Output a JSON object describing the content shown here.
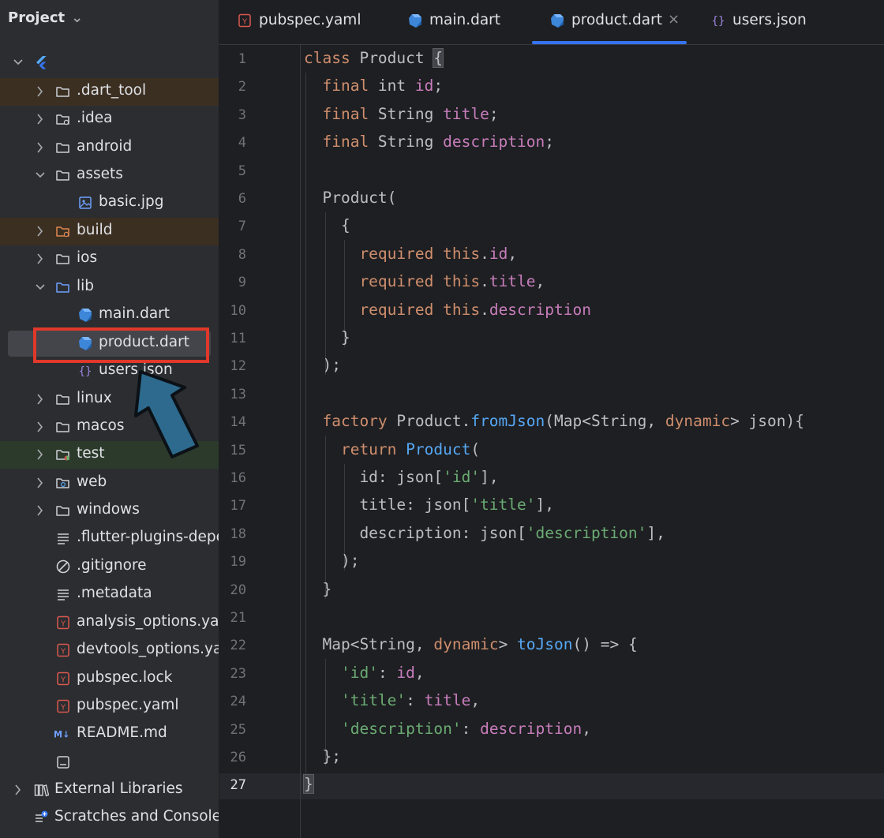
{
  "sidebar": {
    "title": "Project",
    "items": [
      {
        "label": "",
        "icon": "flutter-icon",
        "toggle": "expanded"
      },
      {
        "label": ".dart_tool",
        "icon": "folder-icon",
        "toggle": "collapsed"
      },
      {
        "label": ".idea",
        "icon": "folder-settings-icon",
        "toggle": "collapsed"
      },
      {
        "label": "android",
        "icon": "folder-icon",
        "toggle": "collapsed"
      },
      {
        "label": "assets",
        "icon": "folder-icon",
        "toggle": "expanded"
      },
      {
        "label": "basic.jpg",
        "icon": "image-file-icon",
        "toggle": "none"
      },
      {
        "label": "build",
        "icon": "folder-excluded-icon",
        "toggle": "collapsed"
      },
      {
        "label": "ios",
        "icon": "folder-icon",
        "toggle": "collapsed"
      },
      {
        "label": "lib",
        "icon": "source-folder-icon",
        "toggle": "expanded"
      },
      {
        "label": "main.dart",
        "icon": "dart-file-icon",
        "toggle": "none"
      },
      {
        "label": "product.dart",
        "icon": "dart-file-icon",
        "toggle": "none"
      },
      {
        "label": "users.json",
        "icon": "json-file-icon",
        "toggle": "none"
      },
      {
        "label": "linux",
        "icon": "folder-icon",
        "toggle": "collapsed"
      },
      {
        "label": "macos",
        "icon": "folder-icon",
        "toggle": "collapsed"
      },
      {
        "label": "test",
        "icon": "test-folder-icon",
        "toggle": "collapsed"
      },
      {
        "label": "web",
        "icon": "web-folder-icon",
        "toggle": "collapsed"
      },
      {
        "label": "windows",
        "icon": "folder-icon",
        "toggle": "collapsed"
      },
      {
        "label": ".flutter-plugins-depe",
        "icon": "text-file-icon",
        "toggle": "none"
      },
      {
        "label": ".gitignore",
        "icon": "ignore-file-icon",
        "toggle": "none"
      },
      {
        "label": ".metadata",
        "icon": "text-file-icon",
        "toggle": "none"
      },
      {
        "label": "analysis_options.yan",
        "icon": "yaml-file-icon",
        "toggle": "none"
      },
      {
        "label": "devtools_options.yan",
        "icon": "yaml-file-icon",
        "toggle": "none"
      },
      {
        "label": "pubspec.lock",
        "icon": "yaml-file-icon",
        "toggle": "none"
      },
      {
        "label": "pubspec.yaml",
        "icon": "yaml-file-icon",
        "toggle": "none"
      },
      {
        "label": "README.md",
        "icon": "markdown-file-icon",
        "toggle": "none"
      },
      {
        "label": "",
        "icon": "generic-file-icon",
        "toggle": "none"
      },
      {
        "label": "External Libraries",
        "icon": "libraries-icon",
        "toggle": "collapsed"
      },
      {
        "label": "Scratches and Consoles",
        "icon": "scratches-icon",
        "toggle": "none"
      }
    ]
  },
  "tabs": [
    {
      "label": "pubspec.yaml",
      "icon": "yaml-file-icon",
      "active": false
    },
    {
      "label": "main.dart",
      "icon": "dart-file-icon",
      "active": false
    },
    {
      "label": "product.dart",
      "icon": "dart-file-icon",
      "active": true,
      "close": "×"
    },
    {
      "label": "users.json",
      "icon": "json-file-icon",
      "active": false
    }
  ],
  "editor": {
    "line_numbers": [
      "1",
      "2",
      "3",
      "4",
      "5",
      "6",
      "7",
      "8",
      "9",
      "10",
      "11",
      "12",
      "13",
      "14",
      "15",
      "16",
      "17",
      "18",
      "19",
      "20",
      "21",
      "22",
      "23",
      "24",
      "25",
      "26",
      "27"
    ],
    "current_line": 27,
    "code": [
      [
        {
          "t": "class ",
          "c": "kw"
        },
        {
          "t": "Product ",
          "c": "plain"
        },
        {
          "t": "{",
          "c": "plain bm"
        }
      ],
      [
        {
          "t": "  final ",
          "c": "kw"
        },
        {
          "t": "int ",
          "c": "plain"
        },
        {
          "t": "id",
          "c": "fld"
        },
        {
          "t": ";",
          "c": "plain"
        }
      ],
      [
        {
          "t": "  final ",
          "c": "kw"
        },
        {
          "t": "String ",
          "c": "plain"
        },
        {
          "t": "title",
          "c": "fld"
        },
        {
          "t": ";",
          "c": "plain"
        }
      ],
      [
        {
          "t": "  final ",
          "c": "kw"
        },
        {
          "t": "String ",
          "c": "plain"
        },
        {
          "t": "description",
          "c": "fld"
        },
        {
          "t": ";",
          "c": "plain"
        }
      ],
      [],
      [
        {
          "t": "  Product(",
          "c": "plain"
        }
      ],
      [
        {
          "t": "    {",
          "c": "plain"
        }
      ],
      [
        {
          "t": "      required ",
          "c": "kw"
        },
        {
          "t": "this",
          "c": "kw"
        },
        {
          "t": ".",
          "c": "plain"
        },
        {
          "t": "id",
          "c": "fld"
        },
        {
          "t": ",",
          "c": "plain"
        }
      ],
      [
        {
          "t": "      required ",
          "c": "kw"
        },
        {
          "t": "this",
          "c": "kw"
        },
        {
          "t": ".",
          "c": "plain"
        },
        {
          "t": "title",
          "c": "fld"
        },
        {
          "t": ",",
          "c": "plain"
        }
      ],
      [
        {
          "t": "      required ",
          "c": "kw"
        },
        {
          "t": "this",
          "c": "kw"
        },
        {
          "t": ".",
          "c": "plain"
        },
        {
          "t": "description",
          "c": "fld"
        }
      ],
      [
        {
          "t": "    }",
          "c": "plain"
        }
      ],
      [
        {
          "t": "  );",
          "c": "plain"
        }
      ],
      [],
      [
        {
          "t": "  factory ",
          "c": "kw"
        },
        {
          "t": "Product.",
          "c": "plain"
        },
        {
          "t": "fromJson",
          "c": "fn"
        },
        {
          "t": "(Map<String, ",
          "c": "plain"
        },
        {
          "t": "dynamic",
          "c": "kw"
        },
        {
          "t": "> json){",
          "c": "plain"
        }
      ],
      [
        {
          "t": "    return ",
          "c": "kw"
        },
        {
          "t": "Product",
          "c": "fn"
        },
        {
          "t": "(",
          "c": "plain"
        }
      ],
      [
        {
          "t": "      id: json[",
          "c": "plain"
        },
        {
          "t": "'id'",
          "c": "str"
        },
        {
          "t": "],",
          "c": "plain"
        }
      ],
      [
        {
          "t": "      title: json[",
          "c": "plain"
        },
        {
          "t": "'title'",
          "c": "str"
        },
        {
          "t": "],",
          "c": "plain"
        }
      ],
      [
        {
          "t": "      description: json[",
          "c": "plain"
        },
        {
          "t": "'description'",
          "c": "str"
        },
        {
          "t": "],",
          "c": "plain"
        }
      ],
      [
        {
          "t": "    );",
          "c": "plain"
        }
      ],
      [
        {
          "t": "  }",
          "c": "plain"
        }
      ],
      [],
      [
        {
          "t": "  Map<String, ",
          "c": "plain"
        },
        {
          "t": "dynamic",
          "c": "kw"
        },
        {
          "t": "> ",
          "c": "plain"
        },
        {
          "t": "toJson",
          "c": "fn"
        },
        {
          "t": "() => {",
          "c": "plain"
        }
      ],
      [
        {
          "t": "    ",
          "c": "plain"
        },
        {
          "t": "'id'",
          "c": "str"
        },
        {
          "t": ": ",
          "c": "plain"
        },
        {
          "t": "id",
          "c": "fld"
        },
        {
          "t": ",",
          "c": "plain"
        }
      ],
      [
        {
          "t": "    ",
          "c": "plain"
        },
        {
          "t": "'title'",
          "c": "str"
        },
        {
          "t": ": ",
          "c": "plain"
        },
        {
          "t": "title",
          "c": "fld"
        },
        {
          "t": ",",
          "c": "plain"
        }
      ],
      [
        {
          "t": "    ",
          "c": "plain"
        },
        {
          "t": "'description'",
          "c": "str"
        },
        {
          "t": ": ",
          "c": "plain"
        },
        {
          "t": "description",
          "c": "fld"
        },
        {
          "t": ",",
          "c": "plain"
        }
      ],
      [
        {
          "t": "  };",
          "c": "plain"
        }
      ],
      [
        {
          "t": "}",
          "c": "plain bm"
        }
      ]
    ]
  },
  "colors": {
    "keyword": "#cf8e6d",
    "field": "#c77dbb",
    "string": "#6aab73",
    "function": "#56a8f5",
    "accent": "#3574f0",
    "annotation_box": "#e0382a",
    "annotation_arrow": "#2d6a8e"
  }
}
